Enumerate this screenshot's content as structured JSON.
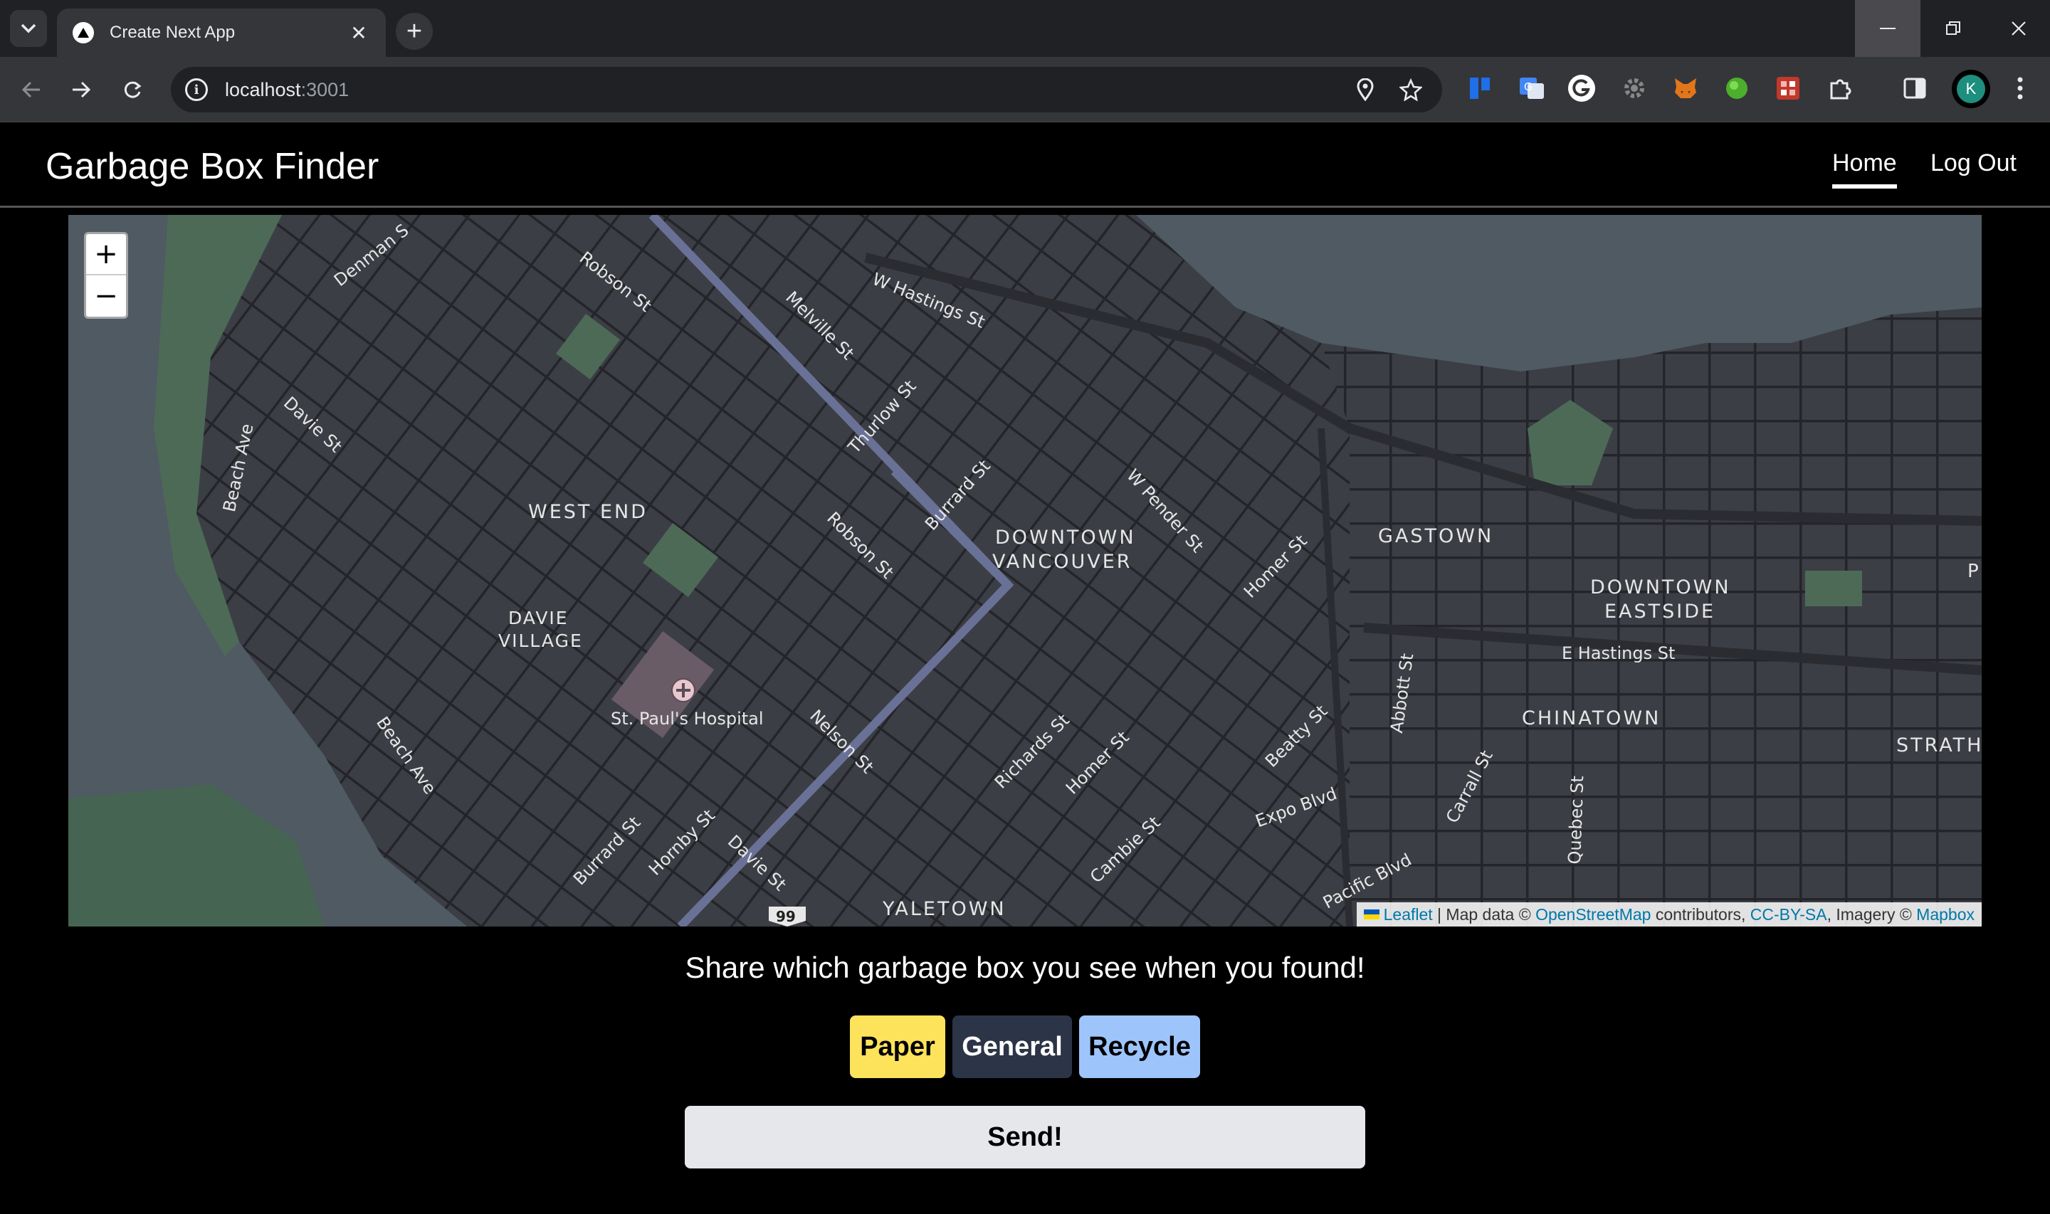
{
  "browser": {
    "tab_title": "Create Next App",
    "url_host": "localhost",
    "url_port": ":3001",
    "profile_initial": "K"
  },
  "app": {
    "title": "Garbage Box Finder",
    "nav": {
      "home": "Home",
      "logout": "Log Out"
    }
  },
  "map": {
    "zoom_in": "+",
    "zoom_out": "−",
    "labels": {
      "west_end": "WEST END",
      "davie_village_1": "DAVIE",
      "davie_village_2": "VILLAGE",
      "downtown_vancouver_1": "DOWNTOWN",
      "downtown_vancouver_2": "VANCOUVER",
      "gastown": "GASTOWN",
      "downtown_eastside_1": "DOWNTOWN",
      "downtown_eastside_2": "EASTSIDE",
      "chinatown": "CHINATOWN",
      "yaletown": "YALETOWN",
      "strath": "STRATH",
      "hospital": "St. Paul's Hospital",
      "e_hastings": "E Hastings St",
      "expo_blvd": "Expo Blvd",
      "pacific_blvd": "Pacific Blvd",
      "denman": "Denman S",
      "robson_1": "Robson St",
      "robson_2": "Robson St",
      "w_hastings": "W Hastings St",
      "melville": "Melville St",
      "thurlow": "Thurlow St",
      "burrard_1": "Burrard St",
      "burrard_2": "Burrard St",
      "w_pender": "W Pender St",
      "homer_1": "Homer St",
      "homer_2": "Homer St",
      "davie_st_1": "Davie St",
      "davie_st_2": "Davie St",
      "beach_ave_1": "Beach Ave",
      "beach_ave_2": "Beach Ave",
      "nelson": "Nelson St",
      "hornby": "Hornby St",
      "richards": "Richards St",
      "cambie": "Cambie St",
      "beatty": "Beatty St",
      "abbott": "Abbott St",
      "carrall": "Carrall St",
      "quebec": "Quebec St",
      "p_edge": "P",
      "shield": "99"
    },
    "attribution": {
      "leaflet": "Leaflet",
      "sep1": " | Map data © ",
      "osm": "OpenStreetMap",
      "sep2": " contributors, ",
      "license": "CC-BY-SA",
      "sep3": ", Imagery © ",
      "mapbox": "Mapbox"
    }
  },
  "form": {
    "prompt": "Share which garbage box you see when you found!",
    "options": {
      "paper": "Paper",
      "general": "General",
      "recycle": "Recycle"
    },
    "send": "Send!"
  },
  "colors": {
    "paper": "#fde35b",
    "general": "#2c3547",
    "recycle": "#9ec5fb",
    "send": "#e5e7eb"
  }
}
